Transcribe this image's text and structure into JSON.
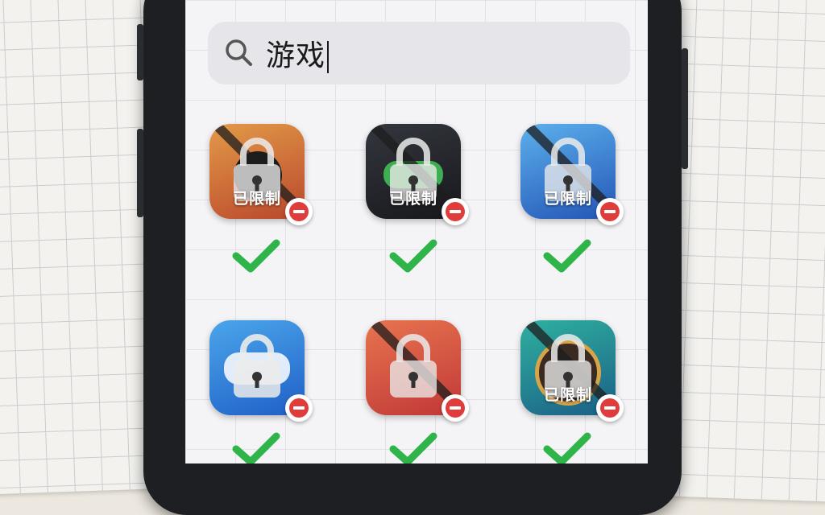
{
  "search": {
    "query": "游戏"
  },
  "apps": [
    {
      "id": "app-1",
      "overlay_label": "已限制",
      "status": "restricted",
      "check": true,
      "colors": [
        "#d9893e",
        "#b5492a"
      ]
    },
    {
      "id": "app-2",
      "overlay_label": "已限制",
      "status": "restricted",
      "check": true,
      "colors": [
        "#2b2d33",
        "#15161a"
      ]
    },
    {
      "id": "app-3",
      "overlay_label": "已限制",
      "status": "restricted",
      "check": true,
      "colors": [
        "#4ea3e3",
        "#2457b8"
      ]
    },
    {
      "id": "app-4",
      "overlay_label": "",
      "status": "restricted",
      "check": true,
      "colors": [
        "#3f9be4",
        "#1f5fc7"
      ]
    },
    {
      "id": "app-5",
      "overlay_label": "",
      "status": "restricted",
      "check": true,
      "colors": [
        "#e36a4a",
        "#c43b3a"
      ]
    },
    {
      "id": "app-6",
      "overlay_label": "已限制",
      "status": "restricted",
      "check": true,
      "colors": [
        "#2aa39a",
        "#1c6a86"
      ]
    }
  ],
  "colors": {
    "check_green": "#2fb44a",
    "badge_red": "#e03c3c",
    "search_bg": "#e6e6ea"
  }
}
